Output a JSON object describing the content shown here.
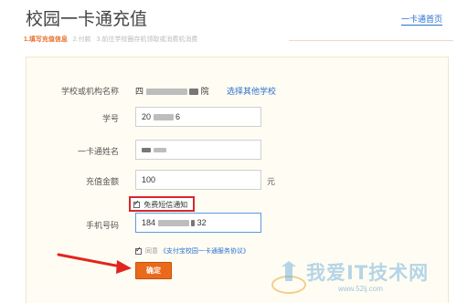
{
  "header": {
    "title": "校园一卡通充值",
    "home_link": "一卡通首页"
  },
  "steps": {
    "step1": "1.填写充值信息",
    "step2": "2.付款",
    "step3": "3.前往学校圈存机领取或消费机消费"
  },
  "form": {
    "school_label": "学校或机构名称",
    "school_value_start": "四",
    "school_value_end": "院",
    "other_school_link": "选择其他学校",
    "student_id_label": "学号",
    "student_id_start": "20",
    "student_id_end": "6",
    "name_label": "一卡通姓名",
    "amount_label": "充值金额",
    "amount_value": "100",
    "amount_unit": "元",
    "sms_label": "免费短信通知",
    "phone_label": "手机号码",
    "phone_start": "184",
    "phone_end": "32",
    "agree_prefix": "同意",
    "agree_link": "《支付宝校园一卡通服务协议》",
    "confirm_label": "确定"
  },
  "watermark": {
    "text": "我爱IT技术网",
    "url": "www.52ij.com"
  },
  "colors": {
    "accent_orange": "#ea6a1b",
    "link_blue": "#2a6fcf",
    "highlight_red": "#d8262d",
    "panel_bg": "#fffdf3"
  }
}
